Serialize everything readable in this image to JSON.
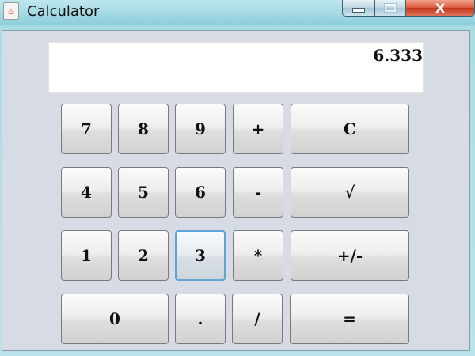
{
  "window": {
    "title": "Calculator",
    "app_icon": "java-cup-icon",
    "controls": {
      "minimize_icon": "minimize-icon",
      "maximize_icon": "maximize-icon",
      "close_label": "X"
    }
  },
  "display": {
    "value": "6.333"
  },
  "keys": {
    "k7": "7",
    "k8": "8",
    "k9": "9",
    "plus": "+",
    "clear": "C",
    "k4": "4",
    "k5": "5",
    "k6": "6",
    "minus": "-",
    "sqrt": "√",
    "k1": "1",
    "k2": "2",
    "k3": "3",
    "multiply": "*",
    "negate": "+/-",
    "k0": "0",
    "decimal": ".",
    "divide": "/",
    "equals": "="
  },
  "focused_key": "3",
  "colors": {
    "client_bg": "#d7dbe3",
    "focus_ring": "#5ea4d6",
    "close_button": "#c2361a"
  }
}
